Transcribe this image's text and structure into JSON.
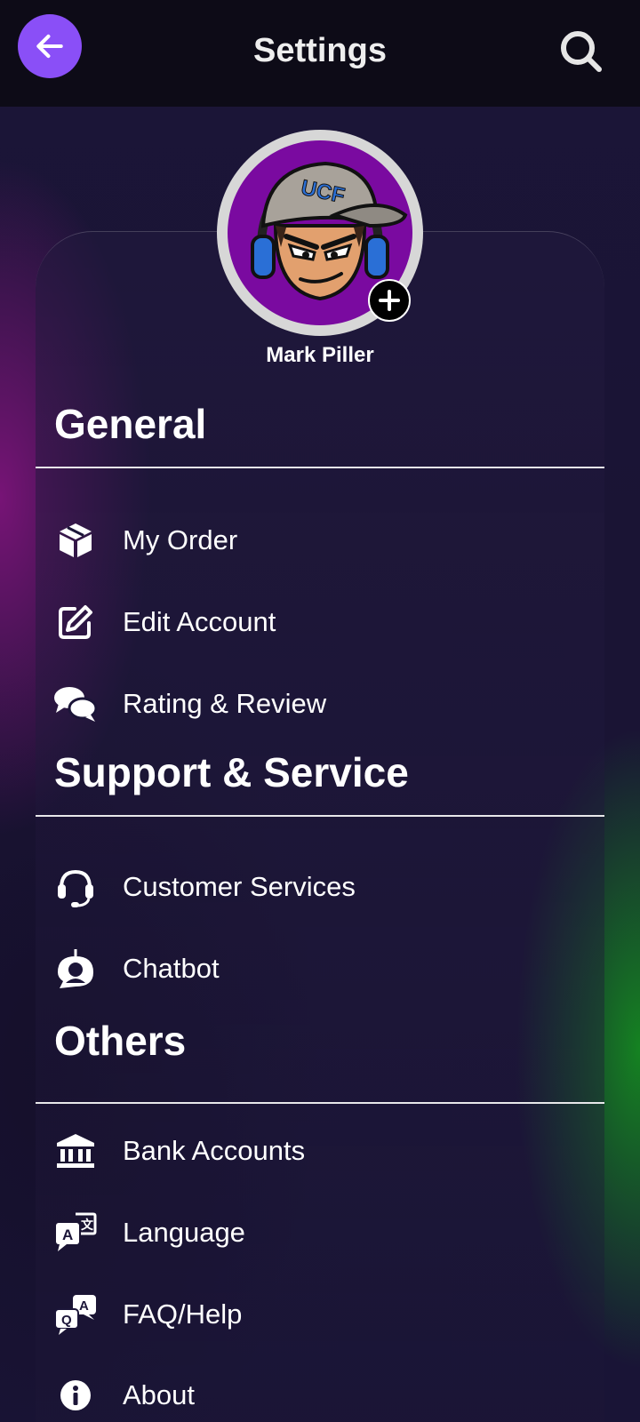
{
  "header": {
    "title": "Settings",
    "back_icon": "arrow-left-icon",
    "search_icon": "search-icon"
  },
  "profile": {
    "name": "Mark Piller",
    "avatar_icon": "avatar-icon",
    "add_icon": "plus-icon"
  },
  "sections": {
    "general": {
      "title": "General",
      "items": [
        {
          "label": "My Order",
          "icon": "box-icon"
        },
        {
          "label": "Edit Account",
          "icon": "edit-icon"
        },
        {
          "label": "Rating & Review",
          "icon": "chat-bubbles-icon"
        }
      ]
    },
    "support": {
      "title": "Support & Service",
      "items": [
        {
          "label": "Customer Services",
          "icon": "headset-icon"
        },
        {
          "label": "Chatbot",
          "icon": "chatbot-icon"
        }
      ]
    },
    "others": {
      "title": "Others",
      "items": [
        {
          "label": "Bank Accounts",
          "icon": "bank-icon"
        },
        {
          "label": "Language",
          "icon": "translate-icon"
        },
        {
          "label": "FAQ/Help",
          "icon": "faq-icon"
        },
        {
          "label": "About",
          "icon": "info-icon"
        }
      ]
    }
  },
  "colors": {
    "accent": "#8a4ff7",
    "topbar": "#0d0b17",
    "background": "#1a1434"
  }
}
